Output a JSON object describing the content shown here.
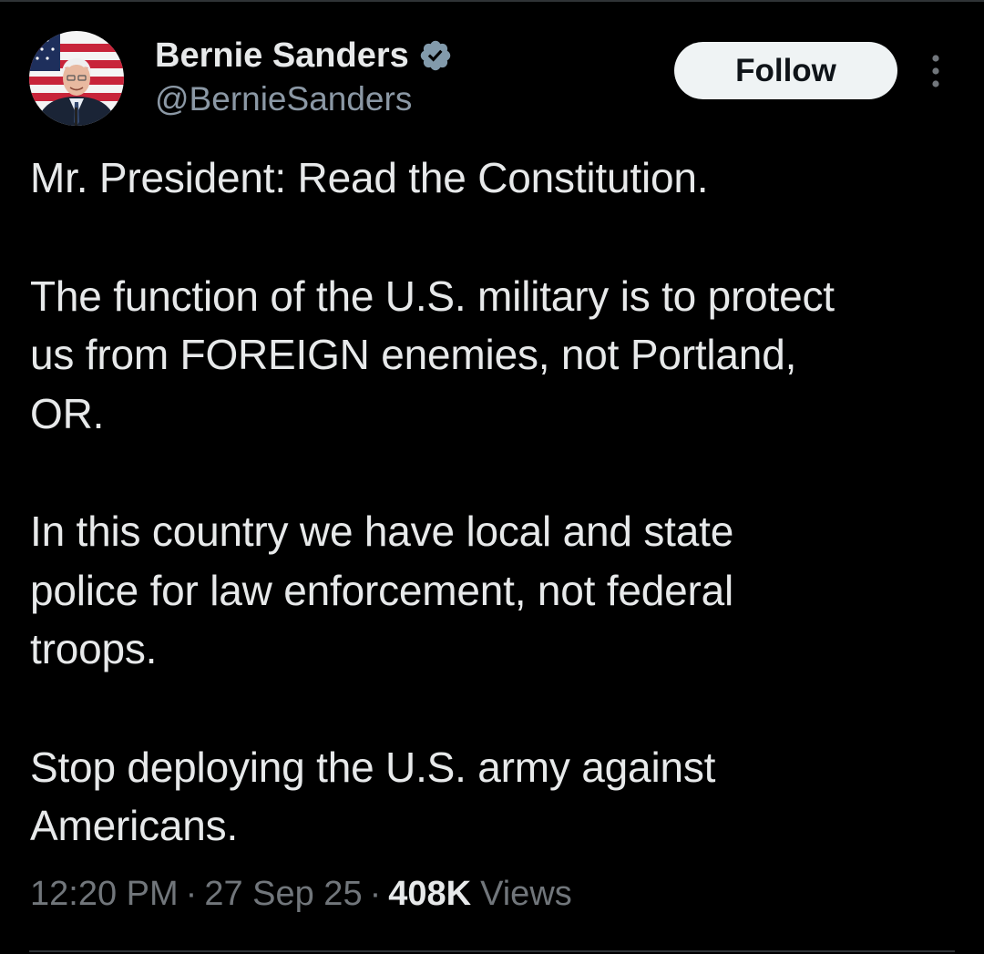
{
  "author": {
    "display_name": "Bernie Sanders",
    "handle": "@BernieSanders",
    "verified_color": "#829aab"
  },
  "header": {
    "follow_label": "Follow",
    "more_icon": "more-vertical-icon"
  },
  "tweet": {
    "paragraphs": [
      "Mr. President: Read the Constitution.",
      "The function of the U.S. military is to protect\nus from FOREIGN enemies, not Portland,\nOR.",
      "In this country we have local and state\npolice for law enforcement, not federal\ntroops.",
      "Stop deploying the U.S. army against\nAmericans."
    ],
    "time": "12:20 PM",
    "separator": "·",
    "date": "27 Sep 25",
    "views_count": "408K",
    "views_label": "Views"
  },
  "colors": {
    "background": "#000000",
    "text_primary": "#e7e9ea",
    "text_secondary": "#71767b",
    "follow_bg": "#eff3f4"
  }
}
